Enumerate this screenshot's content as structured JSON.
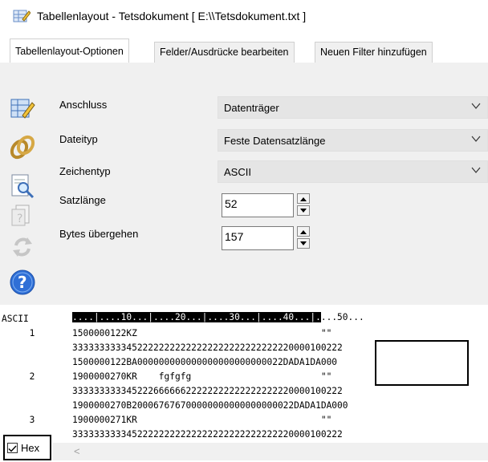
{
  "window": {
    "title": "Tabellenlayout - Tetsdokument [ E:\\\\Tetsdokument.txt ]"
  },
  "tabs": [
    {
      "label": "Tabellenlayout-Optionen",
      "active": true
    },
    {
      "label": "Felder/Ausdrücke bearbeiten",
      "active": false
    },
    {
      "label": "Neuen Filter hinzufügen",
      "active": false
    }
  ],
  "form": {
    "anschluss": {
      "label": "Anschluss",
      "value": "Datenträger"
    },
    "dateityp": {
      "label": "Dateityp",
      "value": "Feste Datensatzlänge"
    },
    "zeichentyp": {
      "label": "Zeichentyp",
      "value": "ASCII"
    },
    "satzlaenge": {
      "label": "Satzlänge",
      "value": "52"
    },
    "bytes": {
      "label": "Bytes übergehen",
      "value": "157"
    }
  },
  "icons": [
    "table-edit-icon",
    "link-icon",
    "search-document-icon",
    "document-icon",
    "refresh-icon",
    "help-icon"
  ],
  "grid": {
    "header_label": "ASCII",
    "ruler": "....|....10...|....20...|....30...|....40...|....50...",
    "ruler_dark_chars": 46,
    "rows": [
      {
        "num": "1",
        "text": "1500000122KZ                                  \"\""
      },
      {
        "num": "",
        "text": "33333333334522222222222222222222222222220000100222"
      },
      {
        "num": "",
        "text": "1500000122BA000000000000000000000000022DADA1DA000"
      },
      {
        "num": "2",
        "text": "1900000270KR    fgfgfg                        \"\""
      },
      {
        "num": "",
        "text": "33333333334522266666622222222222222222220000100222"
      },
      {
        "num": "",
        "text": "1900000270B200067676700000000000000000022DADA1DA000"
      },
      {
        "num": "3",
        "text": "1900000271KR                                  \"\""
      },
      {
        "num": "",
        "text": "33333333334522222222222222222222222222220000100222"
      }
    ]
  },
  "hex": {
    "label": "Hex",
    "checked": true
  },
  "scroll": {
    "left_arrow": "<"
  },
  "colors": {
    "panel": "#f0f0f0",
    "combo": "#e5e5e5",
    "help_blue": "#2f6fd6"
  }
}
